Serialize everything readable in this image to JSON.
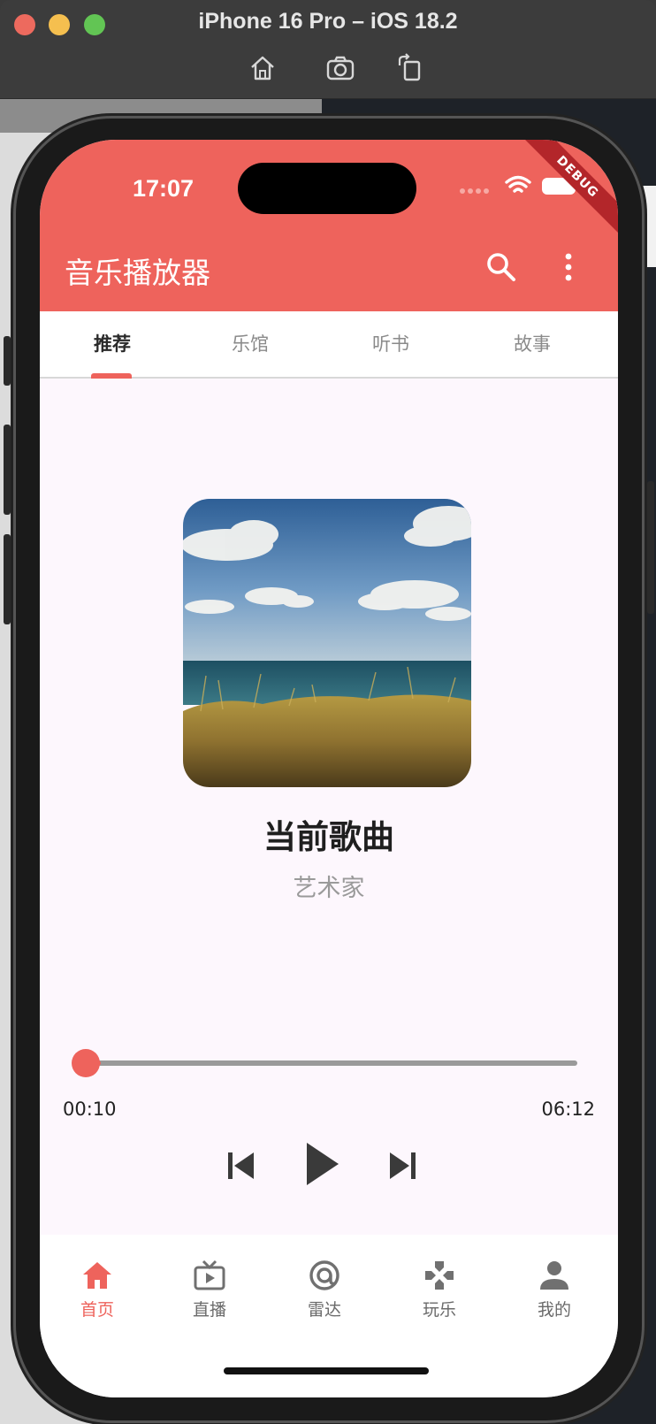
{
  "window": {
    "title": "iPhone 16 Pro – iOS 18.2",
    "tools": [
      "home-icon",
      "camera-icon",
      "rotate-icon"
    ]
  },
  "status_bar": {
    "time": "17:07",
    "badge": "DEBUG"
  },
  "app_bar": {
    "title": "音乐播放器",
    "actions": [
      "search-icon",
      "more-vert-icon"
    ]
  },
  "tabs": [
    {
      "label": "推荐",
      "active": true
    },
    {
      "label": "乐馆",
      "active": false
    },
    {
      "label": "听书",
      "active": false
    },
    {
      "label": "故事",
      "active": false
    }
  ],
  "player": {
    "cover_image": "sky-sea-grass-photo",
    "song_title": "当前歌曲",
    "artist": "艺术家",
    "current_time": "00:10",
    "total_time": "06:12",
    "progress": 0.027,
    "controls": [
      "skip-previous-icon",
      "play-icon",
      "skip-next-icon"
    ]
  },
  "bottom_nav": [
    {
      "label": "首页",
      "icon": "home-icon",
      "active": true
    },
    {
      "label": "直播",
      "icon": "live-tv-icon",
      "active": false
    },
    {
      "label": "雷达",
      "icon": "radar-icon",
      "active": false
    },
    {
      "label": "玩乐",
      "icon": "game-icon",
      "active": false
    },
    {
      "label": "我的",
      "icon": "person-icon",
      "active": false
    }
  ],
  "colors": {
    "accent": "#ee635c",
    "page_bg": "#fdf7fd"
  }
}
